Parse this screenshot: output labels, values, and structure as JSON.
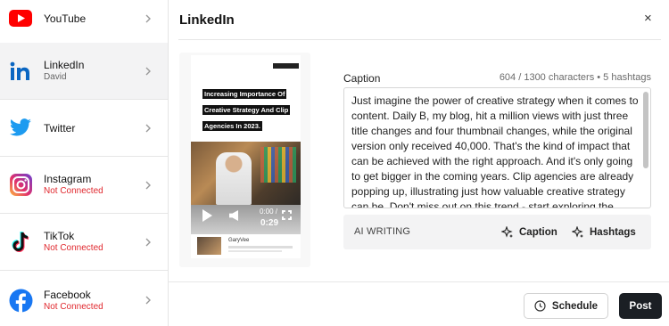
{
  "sidebar": {
    "items": [
      {
        "name": "YouTube",
        "sub": "",
        "icon": "youtube-icon",
        "active": false
      },
      {
        "name": "LinkedIn",
        "sub": "David",
        "icon": "linkedin-icon",
        "active": true
      },
      {
        "name": "Twitter",
        "sub": "",
        "icon": "twitter-icon",
        "active": false
      },
      {
        "name": "Instagram",
        "sub": "Not Connected",
        "icon": "instagram-icon",
        "active": false
      },
      {
        "name": "TikTok",
        "sub": "Not Connected",
        "icon": "tiktok-icon",
        "active": false
      },
      {
        "name": "Facebook",
        "sub": "Not Connected",
        "icon": "facebook-icon",
        "active": false
      }
    ]
  },
  "dialog": {
    "title": "LinkedIn",
    "close_label": "×"
  },
  "preview": {
    "banner": "Increasing Importance Of Creative Strategy And Clip Agencies In 2023.",
    "time_current": "0:00 / ",
    "time_total": "0:29",
    "channel_name": "GaryVee"
  },
  "caption": {
    "label": "Caption",
    "count": "604 / 1300 characters • 5 hashtags",
    "text": "Just imagine the power of creative strategy when it comes to content. Daily B, my blog, hit a million views with just three title changes and four thumbnail changes, while the original version only received 40,000. That's the kind of impact that can be achieved with the right approach. And it's only going to get bigger in the coming years. Clip agencies are already popping up, illustrating just how valuable creative strategy can be. Don't miss out on this trend - start exploring the potential of creative strategy today! #contentcreation #creativestrategy #clipagency"
  },
  "ai": {
    "label": "AI WRITING",
    "caption_btn": "Caption",
    "hashtags_btn": "Hashtags"
  },
  "footer": {
    "schedule_label": "Schedule",
    "post_label": "Post"
  },
  "colors": {
    "youtube": "#ff0000",
    "linkedin": "#0a66c2",
    "twitter": "#1d9bf0",
    "facebook": "#1877f2",
    "not_connected": "#e0282e",
    "post_button": "#1b1f24"
  }
}
